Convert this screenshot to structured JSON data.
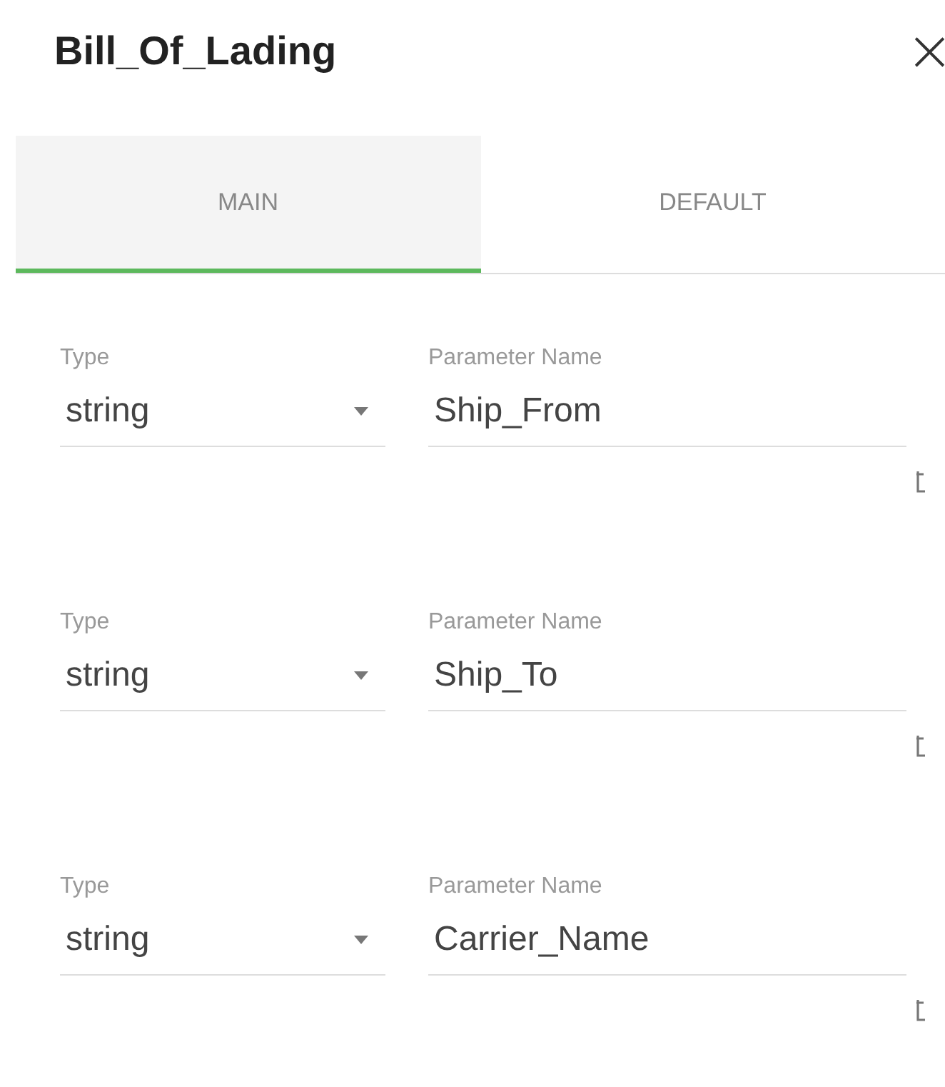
{
  "dialog": {
    "title": "Bill_Of_Lading",
    "close": "×"
  },
  "tabs": [
    {
      "label": "MAIN",
      "selected": true
    },
    {
      "label": "DEFAULT",
      "selected": false
    }
  ],
  "parameters": [
    {
      "type_label": "Type",
      "type_value": "string",
      "name_label": "Parameter Name",
      "name_value": "Ship_From"
    },
    {
      "type_label": "Type",
      "type_value": "string",
      "name_label": "Parameter Name",
      "name_value": "Ship_To"
    },
    {
      "type_label": "Type",
      "type_value": "string",
      "name_label": "Parameter Name",
      "name_value": "Carrier_Name"
    }
  ]
}
